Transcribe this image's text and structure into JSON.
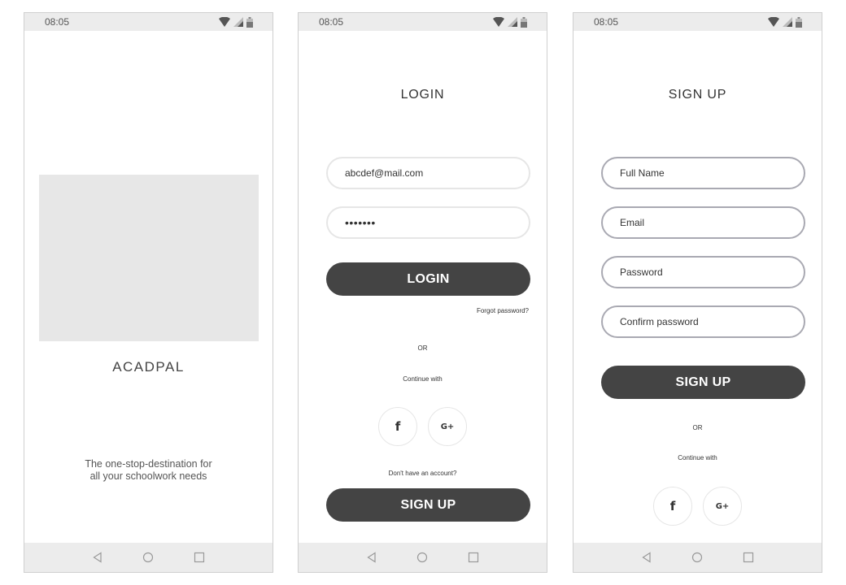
{
  "status_bar": {
    "time": "08:05"
  },
  "splash": {
    "app_name": "ACADPAL",
    "tagline_line1": "The one-stop-destination for",
    "tagline_line2": "all your schoolwork needs"
  },
  "login": {
    "title": "LOGIN",
    "email_value": "abcdef@mail.com",
    "password_value": "•••••••",
    "login_button": "LOGIN",
    "forgot_password": "Forgot password?",
    "or_text": "OR",
    "continue_with": "Continue with",
    "facebook_glyph": "f",
    "google_glyph": "G+",
    "no_account": "Don't have an account?",
    "signup_button": "SIGN UP"
  },
  "signup": {
    "title": "SIGN UP",
    "full_name_placeholder": "Full Name",
    "email_placeholder": "Email",
    "password_placeholder": "Password",
    "confirm_password_placeholder": "Confirm password",
    "signup_button": "SIGN UP",
    "or_text": "OR",
    "continue_with": "Continue with",
    "facebook_glyph": "f",
    "google_glyph": "G+"
  },
  "icons": {
    "wifi": "wifi-icon",
    "signal": "signal-icon",
    "battery": "battery-icon",
    "back": "back-triangle-icon",
    "home": "home-circle-icon",
    "recent": "recent-square-icon"
  },
  "colors": {
    "button": "#444444",
    "bars": "#ececec",
    "placeholder_block": "#e7e7e7",
    "field_border_signup": "#a9a9b2",
    "field_border_login": "#e6e6e6"
  }
}
